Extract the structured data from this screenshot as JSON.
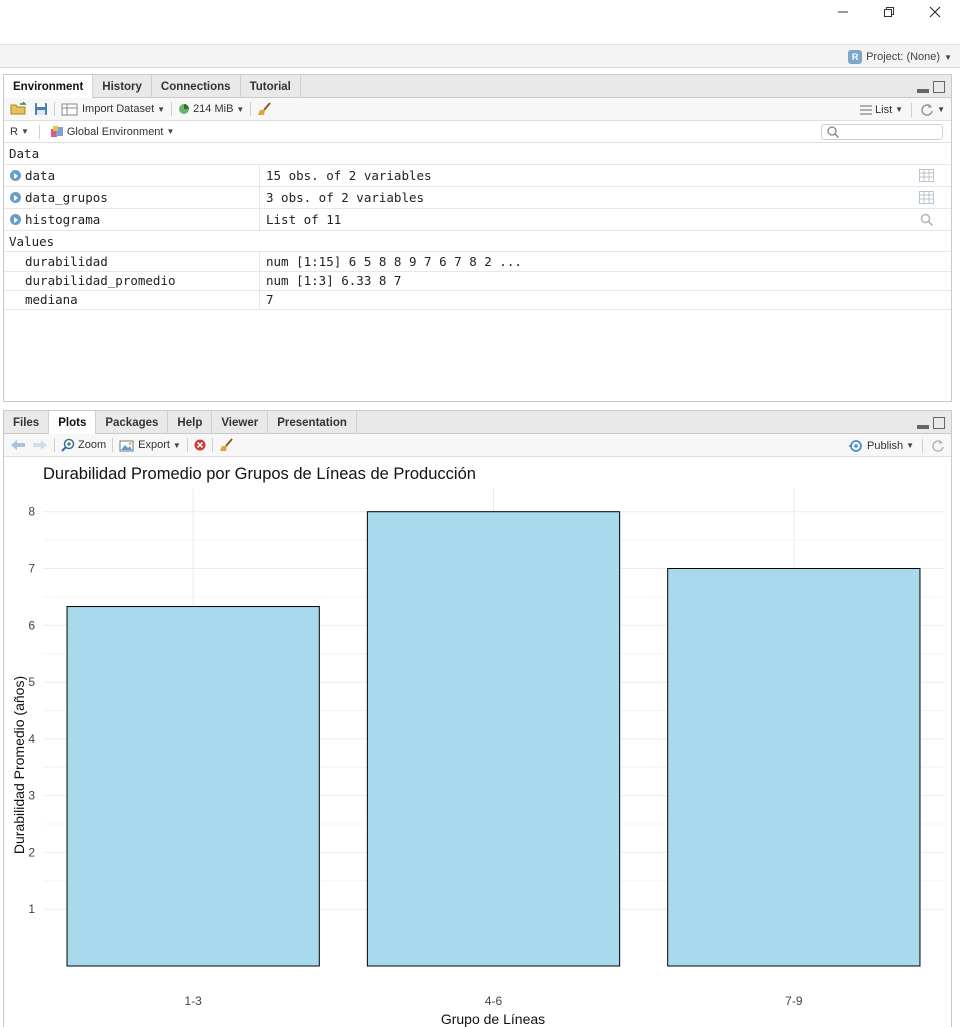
{
  "window": {
    "minimize": "minimize",
    "restore": "restore",
    "close": "close"
  },
  "project": {
    "label": "Project: (None)"
  },
  "env_pane": {
    "tabs": [
      "Environment",
      "History",
      "Connections",
      "Tutorial"
    ],
    "active_tab": "Environment",
    "toolbar": {
      "import_label": "Import Dataset",
      "memory": "214 MiB",
      "view_mode": "List"
    },
    "toolbar2": {
      "language": "R",
      "scope": "Global Environment",
      "search_placeholder": ""
    },
    "data_section": "Data",
    "data_rows": [
      {
        "name": "data",
        "value": "15 obs. of 2 variables",
        "icon": "table-icon"
      },
      {
        "name": "data_grupos",
        "value": "3 obs. of 2 variables",
        "icon": "table-icon"
      },
      {
        "name": "histograma",
        "value": "List of  11",
        "icon": "magnifier-icon"
      }
    ],
    "values_section": "Values",
    "value_rows": [
      {
        "name": "durabilidad",
        "value": "num [1:15] 6 5 8 8 9 7 6 7 8 2 ..."
      },
      {
        "name": "durabilidad_promedio",
        "value": "num [1:3] 6.33 8 7"
      },
      {
        "name": "mediana",
        "value": "7"
      }
    ]
  },
  "plot_pane": {
    "tabs": [
      "Files",
      "Plots",
      "Packages",
      "Help",
      "Viewer",
      "Presentation"
    ],
    "active_tab": "Plots",
    "toolbar": {
      "zoom_label": "Zoom",
      "export_label": "Export",
      "publish_label": "Publish"
    }
  },
  "chart_data": {
    "type": "bar",
    "title": "Durabilidad Promedio por Grupos de Líneas de Producción",
    "xlabel": "Grupo de Líneas",
    "ylabel": "Durabilidad Promedio (años)",
    "categories": [
      "1-3",
      "4-6",
      "7-9"
    ],
    "values": [
      6.33,
      8,
      7
    ],
    "yticks": [
      1,
      2,
      3,
      4,
      5,
      6,
      7,
      8
    ],
    "ylim": [
      0,
      8.4
    ],
    "grid": true,
    "colors": {
      "bar_fill": "#a8daee",
      "bar_stroke": "#000000",
      "grid": "#ebebeb"
    }
  }
}
